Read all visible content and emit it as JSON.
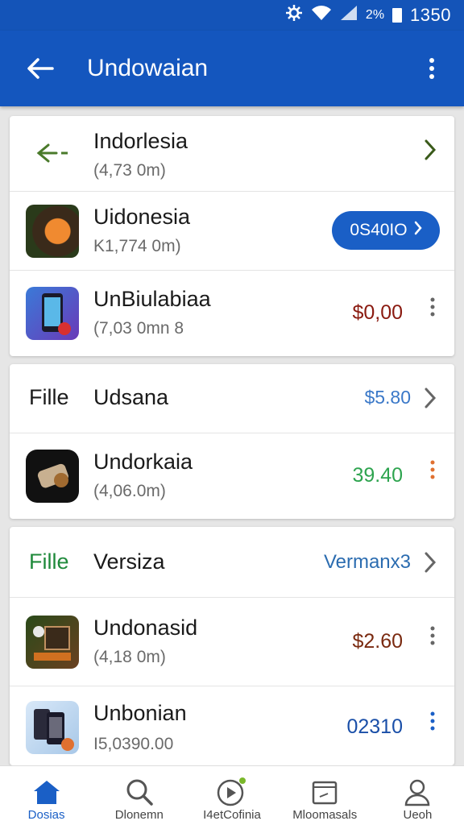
{
  "status_bar": {
    "icons": [
      "gear-icon",
      "wifi-icon",
      "signal-icon",
      "battery-icon"
    ],
    "battery": "2%",
    "time": "1350"
  },
  "app_bar": {
    "title": "Undowaian",
    "back_icon": "back-arrow-icon",
    "menu_icon": "more-vert-icon"
  },
  "sections": [
    {
      "rows": [
        {
          "name": "Indorlesia",
          "sub": "(4,73 0m)",
          "action": "chevron"
        },
        {
          "name": "Uidonesia",
          "sub": "K1,774 0m)",
          "action": "pill",
          "pill_label": "0S40ΙΟ"
        },
        {
          "name": "UnBiulabiaa",
          "sub": "(7,03 0mn 8",
          "price": "$0,00",
          "price_color": "#8a1a10",
          "action": "dots"
        }
      ]
    },
    {
      "rows": [
        {
          "leading_label": "Fille",
          "name": "Udsana",
          "price": "$5.80",
          "price_color": "#3a78c8",
          "action": "chevron"
        },
        {
          "name": "Undorkaia",
          "sub": "(4,06.0m)",
          "price": "39.40",
          "price_color": "#2ea44f",
          "action": "dots",
          "dots_color": "#e07030"
        }
      ]
    },
    {
      "rows": [
        {
          "leading_label": "Fille",
          "leading_color": "#1f8a3b",
          "name": "Versiza",
          "price": "Vermanx3",
          "price_color": "#2b6cb0",
          "action": "chevron"
        },
        {
          "name": "Undonasid",
          "sub": "(4,18 0m)",
          "price": "$2.60",
          "price_color": "#7a2a10",
          "action": "dots"
        },
        {
          "name": "Unbonian",
          "sub": "Ι5,0390.00",
          "price": "02310",
          "price_color": "#1a4fa8",
          "action": "dots",
          "dots_color": "#1a5fc6"
        }
      ]
    }
  ],
  "bottom_nav": [
    {
      "label": "Dosias",
      "icon": "home-icon",
      "active": true
    },
    {
      "label": "Dlonemn",
      "icon": "search-icon",
      "active": false
    },
    {
      "label": "I4etCofinia",
      "icon": "play-icon",
      "active": false
    },
    {
      "label": "Mloomasals",
      "icon": "document-icon",
      "active": false
    },
    {
      "label": "Ueoh",
      "icon": "profile-icon",
      "active": false
    }
  ]
}
